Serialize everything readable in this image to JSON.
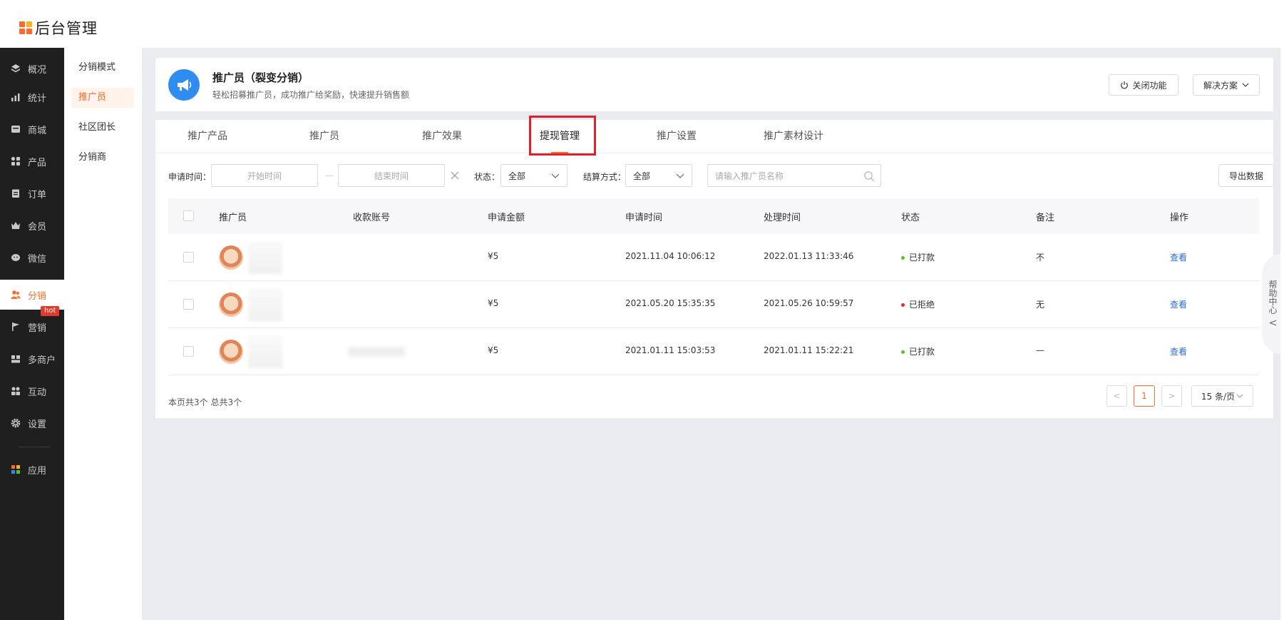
{
  "app": {
    "title": "后台管理",
    "colors": {
      "accent": "#ff6a2a",
      "sidebar_bg": "#1f1f1f",
      "link": "#2f6bd8",
      "success": "#52c41a",
      "danger": "#f5222d",
      "highlight_box": "#e0202a"
    }
  },
  "sidebar": {
    "items": [
      {
        "label": "概况",
        "icon": "layers-icon"
      },
      {
        "label": "统计",
        "icon": "chart-icon"
      },
      {
        "label": "商城",
        "icon": "shop-icon"
      },
      {
        "label": "产品",
        "icon": "grid-icon"
      },
      {
        "label": "订单",
        "icon": "order-icon"
      },
      {
        "label": "会员",
        "icon": "crown-icon"
      },
      {
        "label": "微信",
        "icon": "wechat-icon"
      },
      {
        "label": "分销",
        "icon": "users-icon",
        "active": true
      },
      {
        "label": "营销",
        "icon": "flag-icon",
        "badge": "hot"
      },
      {
        "label": "多商户",
        "icon": "merchant-icon"
      },
      {
        "label": "互动",
        "icon": "interact-icon"
      },
      {
        "label": "设置",
        "icon": "gear-icon"
      },
      {
        "label": "应用",
        "icon": "apps-icon"
      }
    ]
  },
  "subsidebar": {
    "items": [
      {
        "label": "分销模式"
      },
      {
        "label": "推广员",
        "active": true
      },
      {
        "label": "社区团长"
      },
      {
        "label": "分销商"
      }
    ]
  },
  "header": {
    "title": "推广员（裂变分销）",
    "subtitle": "轻松招募推广员，成功推广给奖励，快速提升销售额",
    "close_label": "关闭功能",
    "solution_label": "解决方案"
  },
  "tabs": [
    {
      "label": "推广产品"
    },
    {
      "label": "推广员"
    },
    {
      "label": "推广效果"
    },
    {
      "label": "提现管理",
      "active": true
    },
    {
      "label": "推广设置"
    },
    {
      "label": "推广素材设计"
    }
  ],
  "filters": {
    "apply_time_label": "申请时间：",
    "start_placeholder": "开始时间",
    "end_placeholder": "结束时间",
    "range_sep": "—",
    "status_label": "状态：",
    "status_value": "全部",
    "settle_label": "结算方式：",
    "settle_value": "全部",
    "search_placeholder": "请输入推广员名称",
    "export_label": "导出数据"
  },
  "table": {
    "columns": [
      "推广员",
      "收款账号",
      "申请金额",
      "申请时间",
      "处理时间",
      "状态",
      "备注",
      "操作"
    ],
    "rows": [
      {
        "amount": "¥5",
        "apply_time": "2021.11.04 10:06:12",
        "process_time": "2022.01.13 11:33:46",
        "status": "已打款",
        "status_color": "#52c41a",
        "note": "不",
        "action": "查看"
      },
      {
        "amount": "¥5",
        "apply_time": "2021.05.20 15:35:35",
        "process_time": "2021.05.26 10:59:57",
        "status": "已拒绝",
        "status_color": "#f5222d",
        "note": "无",
        "action": "查看"
      },
      {
        "amount": "¥5",
        "apply_time": "2021.01.11 15:03:53",
        "process_time": "2021.01.11 15:22:21",
        "status": "已打款",
        "status_color": "#52c41a",
        "note": "—",
        "action": "查看"
      }
    ]
  },
  "footer": {
    "summary": "本页共3个 总共3个",
    "prev": "<",
    "page": "1",
    "next": ">",
    "page_size": "15 条/页"
  },
  "help": {
    "chars": [
      "帮",
      "助",
      "中",
      "心"
    ],
    "chevron": "<"
  }
}
